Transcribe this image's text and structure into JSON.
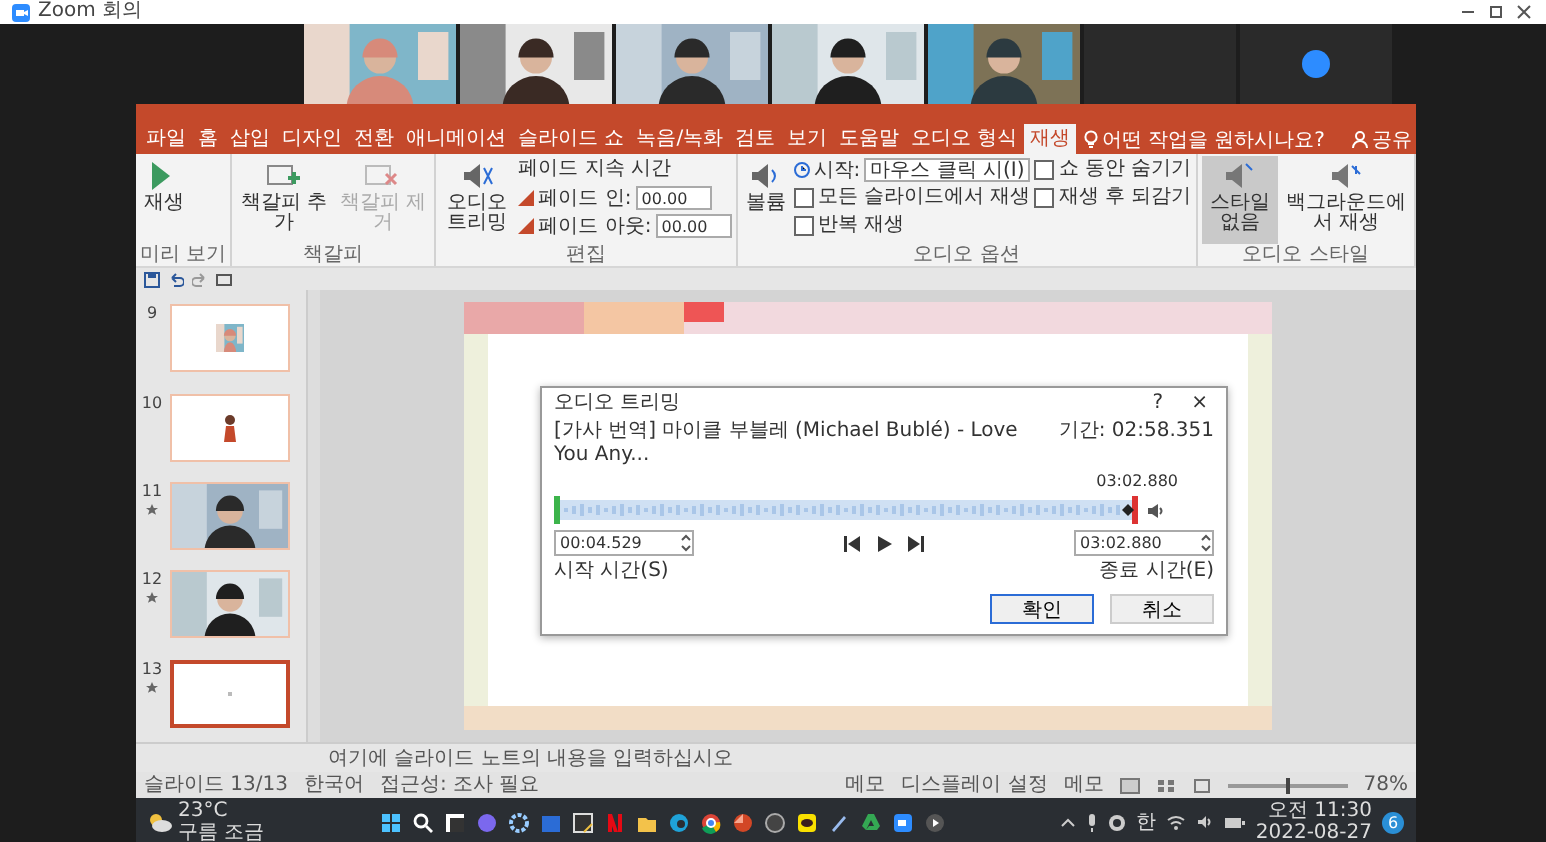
{
  "zoom_window": {
    "title": "Zoom 회의"
  },
  "video_tiles": [
    {
      "kind": "picture"
    },
    {
      "kind": "picture"
    },
    {
      "kind": "picture"
    },
    {
      "kind": "picture"
    },
    {
      "kind": "picture"
    },
    {
      "kind": "blank"
    },
    {
      "kind": "avatar"
    }
  ],
  "powerpoint": {
    "tabs": [
      {
        "label": "파일",
        "selected": false
      },
      {
        "label": "홈",
        "selected": false
      },
      {
        "label": "삽입",
        "selected": false
      },
      {
        "label": "디자인",
        "selected": false
      },
      {
        "label": "전환",
        "selected": false
      },
      {
        "label": "애니메이션",
        "selected": false
      },
      {
        "label": "슬라이드 쇼",
        "selected": false
      },
      {
        "label": "녹음/녹화",
        "selected": false
      },
      {
        "label": "검토",
        "selected": false
      },
      {
        "label": "보기",
        "selected": false
      },
      {
        "label": "도움말",
        "selected": false
      },
      {
        "label": "오디오 형식",
        "selected": false
      },
      {
        "label": "재생",
        "selected": true
      }
    ],
    "tell_me": "어떤 작업을 원하시나요?",
    "share": "공유",
    "ribbon_groups": [
      {
        "label": "미리 보기",
        "items": [
          {
            "kind": "big",
            "label": "재생",
            "disabled": false
          }
        ]
      },
      {
        "label": "책갈피",
        "items": [
          {
            "kind": "big",
            "label": "책갈피 추가",
            "disabled": false
          },
          {
            "kind": "big",
            "label": "책갈피 제거",
            "disabled": true
          }
        ]
      },
      {
        "label": "편집",
        "items": [
          {
            "kind": "big",
            "label": "오디오 트리밍",
            "disabled": false
          },
          {
            "kind": "stack",
            "items": [
              {
                "kind": "heading",
                "label": "페이드 지속 시간"
              },
              {
                "kind": "field",
                "label": "페이드 인:",
                "value": "00.00"
              },
              {
                "kind": "field",
                "label": "페이드 아웃:",
                "value": "00.00"
              }
            ]
          }
        ]
      },
      {
        "label": "오디오 옵션",
        "items": [
          {
            "kind": "big",
            "label": "볼륨",
            "disabled": false
          },
          {
            "kind": "stack",
            "items": [
              {
                "kind": "dropdown",
                "label": "시작:",
                "value": "마우스 클릭 시(I)"
              },
              {
                "kind": "check",
                "label": "모든 슬라이드에서 재생",
                "checked": false
              },
              {
                "kind": "check",
                "label": "반복 재생",
                "checked": false
              }
            ]
          },
          {
            "kind": "stack",
            "items": [
              {
                "kind": "check",
                "label": "쇼 동안 숨기기",
                "checked": false
              },
              {
                "kind": "check",
                "label": "재생 후 되감기",
                "checked": false
              }
            ]
          }
        ]
      },
      {
        "label": "오디오 스타일",
        "items": [
          {
            "kind": "big",
            "label": "스타일 없음",
            "disabled": false,
            "selected": true
          },
          {
            "kind": "big",
            "label": "백그라운드에서 재생",
            "disabled": false,
            "selected": false
          }
        ]
      }
    ],
    "slides": [
      {
        "number": "9",
        "kind": "small-picture",
        "animated": false,
        "selected": false
      },
      {
        "number": "10",
        "kind": "figure",
        "animated": false,
        "selected": false
      },
      {
        "number": "11",
        "animated": true,
        "selected": false
      },
      {
        "number": "12",
        "animated": true,
        "selected": false
      },
      {
        "number": "13",
        "kind": "blank",
        "animated": true,
        "selected": true
      }
    ],
    "notes_placeholder": "여기에 슬라이드 노트의 내용을 입력하십시오",
    "dialog": {
      "title": "오디오 트리밍",
      "help": "?",
      "close": "×",
      "file": "[가사 번역] 마이클 부블레 (Michael Bublé) - Love You Any...",
      "duration": "기간: 02:58.351",
      "marker_time": "03:02.880",
      "start_time": "00:04.529",
      "start_label": "시작 시간(S)",
      "end_time": "03:02.880",
      "end_label": "종료 시간(E)",
      "buttons": [
        {
          "label": "확인",
          "selected": true
        },
        {
          "label": "취소",
          "selected": false
        }
      ]
    },
    "status_bar": {
      "slide": "슬라이드 13/13",
      "language": "한국어",
      "accessibility": "접근성: 조사 필요",
      "notes": "메모",
      "display": "디스플레이 설정",
      "comments": "메모",
      "zoom": {
        "level": 0.48
      },
      "zoom_text": "78%"
    }
  },
  "taskbar": {
    "temperature": "23°C",
    "weather": "구름 조금",
    "ime": "한",
    "time": "오전 11:30",
    "date": "2022-08-27",
    "badge": "6"
  }
}
